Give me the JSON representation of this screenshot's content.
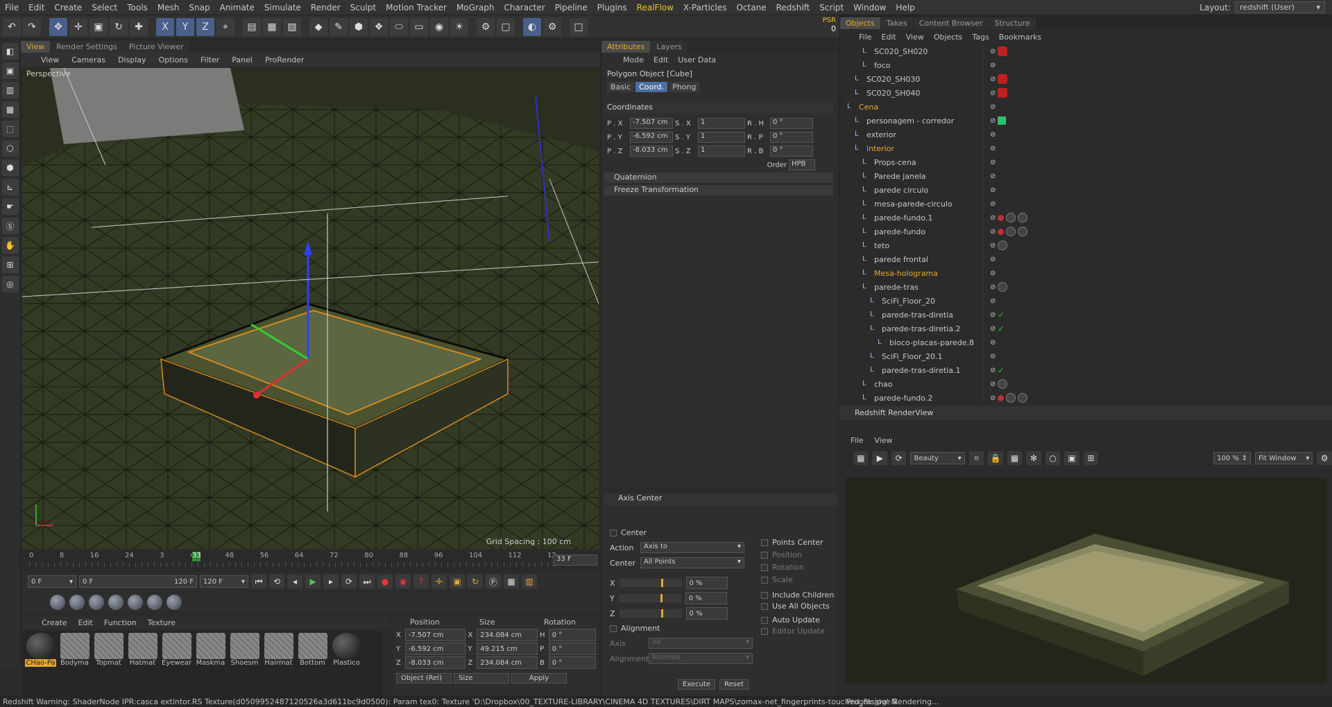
{
  "menubar": {
    "items": [
      "File",
      "Edit",
      "Create",
      "Select",
      "Tools",
      "Mesh",
      "Snap",
      "Animate",
      "Simulate",
      "Render",
      "Sculpt",
      "Motion Tracker",
      "MoGraph",
      "Character",
      "Pipeline",
      "Plugins",
      "RealFlow",
      "X-Particles",
      "Octane",
      "Redshift",
      "Script",
      "Window",
      "Help"
    ],
    "highlight_index": 16,
    "layout_label": "Layout:",
    "layout_value": "redshift (User)"
  },
  "psr": {
    "label": "PSR",
    "value": "0"
  },
  "viewport": {
    "tabs": [
      "View",
      "Render Settings",
      "Picture Viewer"
    ],
    "menu": [
      "View",
      "Cameras",
      "Display",
      "Options",
      "Filter",
      "Panel",
      "ProRender"
    ],
    "label": "Perspective",
    "grid": "Grid Spacing : 100 cm"
  },
  "timeline": {
    "ticks": [
      "0",
      "8",
      "16",
      "24",
      "3",
      "40",
      "48",
      "56",
      "64",
      "72",
      "80",
      "88",
      "96",
      "104",
      "112",
      "12"
    ],
    "current": "33",
    "end": "33 F",
    "start_field": "0 F",
    "range_start": "0 F",
    "range_end": "120 F",
    "end_field": "120 F"
  },
  "materials": {
    "menu": [
      "Create",
      "Edit",
      "Function",
      "Texture"
    ],
    "items": [
      {
        "name": "CHao-Pa",
        "kind": "round",
        "selected": true
      },
      {
        "name": "Bodyma",
        "kind": "stripe"
      },
      {
        "name": "Topmat",
        "kind": "stripe"
      },
      {
        "name": "Hatmat",
        "kind": "stripe"
      },
      {
        "name": "Eyewear",
        "kind": "stripe"
      },
      {
        "name": "Maskma",
        "kind": "stripe"
      },
      {
        "name": "Shoesm",
        "kind": "stripe"
      },
      {
        "name": "Hairmat",
        "kind": "stripe"
      },
      {
        "name": "Bottom",
        "kind": "stripe"
      },
      {
        "name": "Plastico",
        "kind": "round"
      }
    ]
  },
  "coord_manager": {
    "headers": [
      "Position",
      "Size",
      "Rotation"
    ],
    "rows": [
      {
        "axis": "X",
        "pos": "-7.507 cm",
        "size_axis": "X",
        "size": "234.084 cm",
        "rot_axis": "H",
        "rot": "0 °"
      },
      {
        "axis": "Y",
        "pos": "-6.592 cm",
        "size_axis": "Y",
        "size": "49.215 cm",
        "rot_axis": "P",
        "rot": "0 °"
      },
      {
        "axis": "Z",
        "pos": "-8.033 cm",
        "size_axis": "Z",
        "size": "234.084 cm",
        "rot_axis": "B",
        "rot": "0 °"
      }
    ],
    "mode": "Object (Rel)",
    "size_mode": "Size",
    "apply": "Apply"
  },
  "attributes": {
    "tabs": [
      "Attributes",
      "Layers"
    ],
    "menu": [
      "Mode",
      "Edit",
      "User Data"
    ],
    "title": "Polygon Object [Cube]",
    "subtabs": [
      "Basic",
      "Coord.",
      "Phong"
    ],
    "active_subtab": 1,
    "section": "Coordinates",
    "rows": [
      {
        "p": "P . X",
        "pv": "-7.507 cm",
        "s": "S . X",
        "sv": "1",
        "r": "R . H",
        "rv": "0 °"
      },
      {
        "p": "P . Y",
        "pv": "-6.592 cm",
        "s": "S . Y",
        "sv": "1",
        "r": "R . P",
        "rv": "0 °"
      },
      {
        "p": "P . Z",
        "pv": "-8.033 cm",
        "s": "S . Z",
        "sv": "1",
        "r": "R . B",
        "rv": "0 °"
      }
    ],
    "order_label": "Order",
    "order_value": "HPB",
    "groups": [
      "Quaternion",
      "Freeze Transformation"
    ]
  },
  "axis_center": {
    "title": "Axis Center",
    "center_chk": "Center",
    "action_label": "Action",
    "action_value": "Axis to",
    "center_label": "Center",
    "center_value": "All Points",
    "sliders": [
      {
        "axis": "X",
        "value": "0 %"
      },
      {
        "axis": "Y",
        "value": "0 %"
      },
      {
        "axis": "Z",
        "value": "0 %"
      }
    ],
    "alignment_chk": "Alignment",
    "axis_label": "Axis",
    "axis_value": "All",
    "align_label": "Alignment",
    "align_value": "Normals",
    "right": [
      "Points Center",
      "Position",
      "Rotation",
      "Scale",
      "Include Children",
      "Use All Objects",
      "Auto Update",
      "Editor Update"
    ],
    "execute": "Execute",
    "reset": "Reset"
  },
  "objects": {
    "tabs": [
      "Objects",
      "Takes",
      "Content Browser",
      "Structure"
    ],
    "menu": [
      "File",
      "Edit",
      "View",
      "Objects",
      "Tags",
      "Bookmarks"
    ],
    "rows": [
      {
        "name": "SC020_SH020",
        "indent": 2,
        "tags": "hex"
      },
      {
        "name": "foco",
        "indent": 2,
        "tags": ""
      },
      {
        "name": "SC020_SH030",
        "indent": 1,
        "tags": "hex"
      },
      {
        "name": "SC020_SH040",
        "indent": 1,
        "tags": "hex"
      },
      {
        "name": "Cena",
        "indent": 0,
        "tags": "",
        "orange": true
      },
      {
        "name": "personagem - corredor",
        "indent": 1,
        "tags": "grn"
      },
      {
        "name": "exterior",
        "indent": 1,
        "tags": ""
      },
      {
        "name": "interior",
        "indent": 1,
        "tags": "",
        "orange": true
      },
      {
        "name": "Props-cena",
        "indent": 2,
        "tags": ""
      },
      {
        "name": "Parede janela",
        "indent": 2,
        "tags": ""
      },
      {
        "name": "parede circulo",
        "indent": 2,
        "tags": ""
      },
      {
        "name": "mesa-parede-circulo",
        "indent": 2,
        "tags": ""
      },
      {
        "name": "parede-fundo.1",
        "indent": 2,
        "tags": "mat"
      },
      {
        "name": "parede-fundo",
        "indent": 2,
        "tags": "mat"
      },
      {
        "name": "teto",
        "indent": 2,
        "tags": "sphere"
      },
      {
        "name": "parede frontal",
        "indent": 2,
        "tags": ""
      },
      {
        "name": "Mesa-holograma",
        "indent": 2,
        "tags": "",
        "orange": true
      },
      {
        "name": "parede-tras",
        "indent": 2,
        "tags": "sphere"
      },
      {
        "name": "SciFi_Floor_20",
        "indent": 3,
        "tags": ""
      },
      {
        "name": "parede-tras-diretia",
        "indent": 3,
        "tags": "check"
      },
      {
        "name": "parede-tras-diretia.2",
        "indent": 3,
        "tags": "check"
      },
      {
        "name": "bloco-placas-parede.8",
        "indent": 4,
        "tags": ""
      },
      {
        "name": "SciFi_Floor_20.1",
        "indent": 3,
        "tags": ""
      },
      {
        "name": "parede-tras-diretia.1",
        "indent": 3,
        "tags": "check"
      },
      {
        "name": "chao",
        "indent": 2,
        "tags": "sphere"
      },
      {
        "name": "parede-fundo.2",
        "indent": 2,
        "tags": "mat"
      }
    ]
  },
  "renderview": {
    "title": "Redshift RenderView",
    "menu": [
      "File",
      "View"
    ],
    "aov": "Beauty",
    "zoom": "100 %",
    "fit": "Fit Window"
  },
  "status": {
    "message": "Redshift Warning: ShaderNode IPR:casca extintor.RS Texture(d0509952487120526a3d611bc9d0500): Param tex0: Texture 'D:\\Dropbox\\00_TEXTURE-LIBRARY\\CINEMA 4D TEXTURES\\DIRT MAPS\\zomax-net_fingerprints-touched_8k.jpg' N",
    "right": "Progressive Rendering..."
  }
}
